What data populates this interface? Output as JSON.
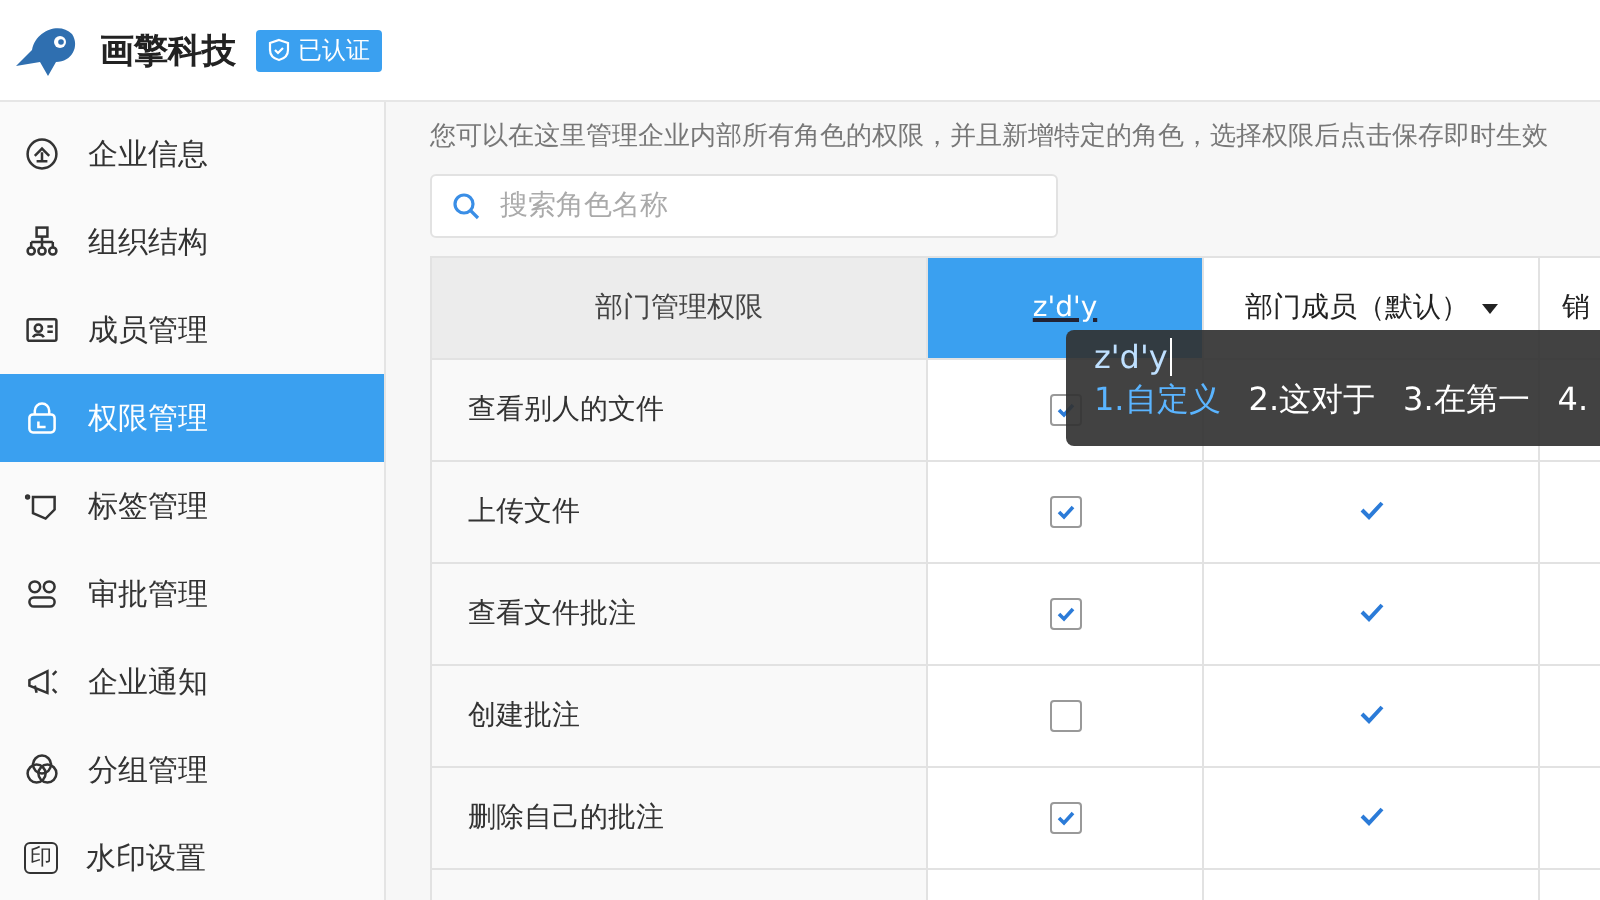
{
  "header": {
    "brand": "画擎科技",
    "badge": "已认证"
  },
  "sidebar": {
    "items": [
      {
        "label": "企业信息",
        "selected": false
      },
      {
        "label": "组织结构",
        "selected": false
      },
      {
        "label": "成员管理",
        "selected": false
      },
      {
        "label": "权限管理",
        "selected": true
      },
      {
        "label": "标签管理",
        "selected": false
      },
      {
        "label": "审批管理",
        "selected": false
      },
      {
        "label": "企业通知",
        "selected": false
      },
      {
        "label": "分组管理",
        "selected": false
      },
      {
        "label": "水印设置",
        "selected": false,
        "icon_text": "印"
      }
    ]
  },
  "description": "您可以在这里管理企业内部所有角色的权限，并且新增特定的角色，选择权限后点击保存即时生效",
  "search": {
    "placeholder": "搜索角色名称"
  },
  "table": {
    "columns": [
      {
        "label": "部门管理权限",
        "editing": false,
        "has_menu": false
      },
      {
        "label": "z'd'y",
        "editing": true,
        "has_menu": false
      },
      {
        "label": "部门成员（默认）",
        "editing": false,
        "has_menu": true
      },
      {
        "label": "销",
        "editing": false
      }
    ],
    "rows": [
      {
        "label": "查看别人的文件",
        "checked": true
      },
      {
        "label": "上传文件",
        "checked": true,
        "granted": true
      },
      {
        "label": "查看文件批注",
        "checked": true,
        "granted": true
      },
      {
        "label": "创建批注",
        "checked": false,
        "granted": true
      },
      {
        "label": "删除自己的批注",
        "checked": true,
        "granted": true
      },
      {}
    ]
  },
  "ime": {
    "input": "z'd'y",
    "candidates": [
      {
        "text": "1.自定义",
        "selected": true
      },
      {
        "text": "2.这对于",
        "selected": false
      },
      {
        "text": "3.在第一",
        "selected": false
      },
      {
        "text": "4.",
        "selected": false
      }
    ]
  }
}
